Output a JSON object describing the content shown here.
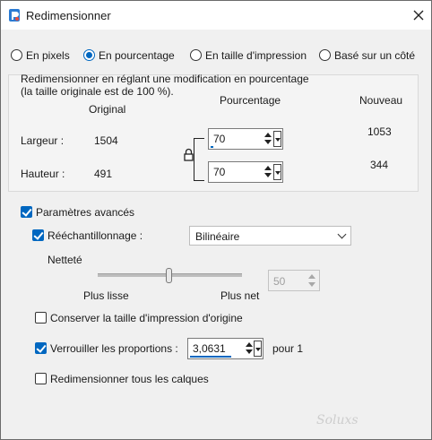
{
  "window": {
    "title": "Redimensionner"
  },
  "modes": [
    {
      "label": "En pixels",
      "selected": false
    },
    {
      "label": "En pourcentage",
      "selected": true
    },
    {
      "label": "En taille d'impression",
      "selected": false
    },
    {
      "label": "Basé sur un côté",
      "selected": false
    }
  ],
  "group": {
    "description_line1": "Redimensionner en réglant une modification en pourcentage",
    "description_line2": "(la taille originale est de 100 %).",
    "col_original": "Original",
    "col_percent": "Pourcentage",
    "col_new": "Nouveau",
    "width_label": "Largeur :",
    "width_original": "1504",
    "width_percent": "70",
    "width_new": "1053",
    "height_label": "Hauteur :",
    "height_original": "491",
    "height_percent": "70",
    "height_new": "344"
  },
  "advanced": {
    "label": "Paramètres avancés",
    "checked": true,
    "resampling_label": "Rééchantillonnage :",
    "resampling_checked": true,
    "resampling_value": "Bilinéaire",
    "sharpness_label": "Netteté",
    "sharpness_value": "50",
    "sharpness_level": 50,
    "smoother_label": "Plus lisse",
    "sharper_label": "Plus net",
    "keep_print_size_label": "Conserver la taille d'impression d'origine",
    "keep_print_size_checked": false,
    "lock_ratio_label": "Verrouiller les proportions :",
    "lock_ratio_checked": true,
    "ratio_value": "3,0631",
    "ratio_suffix": "pour 1",
    "resize_all_layers_label": "Redimensionner tous les calques",
    "resize_all_layers_checked": false
  },
  "watermark": "Soluxs"
}
